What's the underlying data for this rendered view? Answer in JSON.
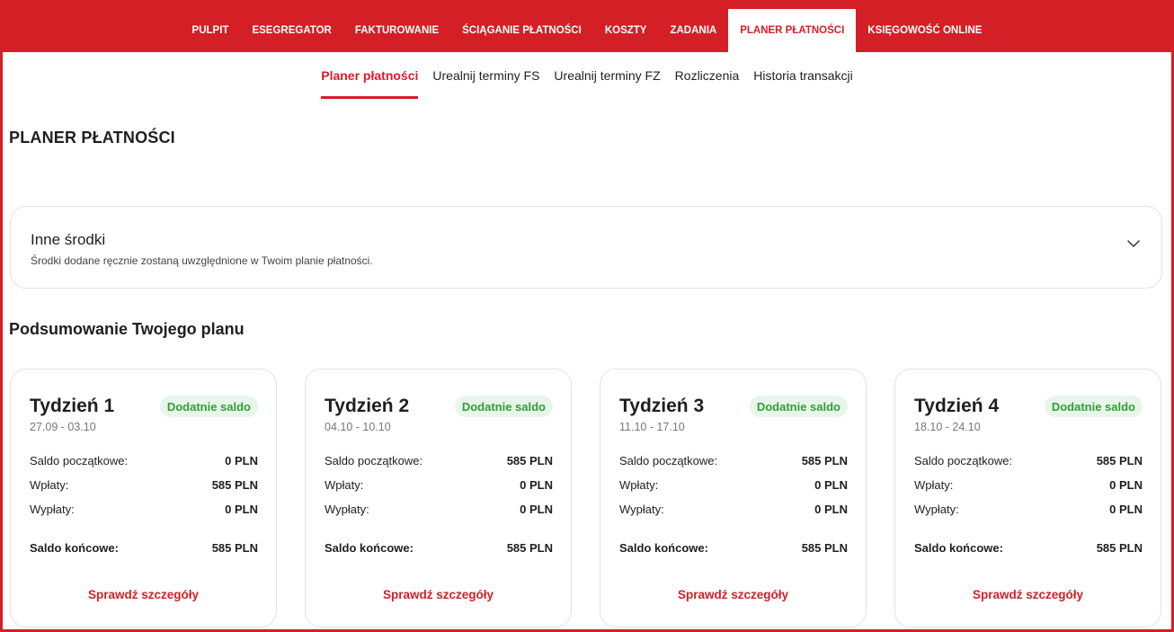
{
  "colors": {
    "brand": "#d51f26",
    "badge_bg": "#e8f6e9",
    "badge_text": "#2f9e3a"
  },
  "topnav": {
    "items": [
      {
        "label": "PULPIT"
      },
      {
        "label": "ESEGREGATOR"
      },
      {
        "label": "FAKTUROWANIE"
      },
      {
        "label": "ŚCIĄGANIE PŁATNOŚCI"
      },
      {
        "label": "KOSZTY"
      },
      {
        "label": "ZADANIA"
      },
      {
        "label": "PLANER PŁATNOŚCI",
        "active": true
      },
      {
        "label": "KSIĘGOWOŚĆ ONLINE"
      }
    ]
  },
  "subnav": {
    "items": [
      {
        "label": "Planer płatności",
        "active": true
      },
      {
        "label": "Urealnij terminy FS"
      },
      {
        "label": "Urealnij terminy FZ"
      },
      {
        "label": "Rozliczenia"
      },
      {
        "label": "Historia transakcji"
      }
    ]
  },
  "page": {
    "title": "PLANER PŁATNOŚCI"
  },
  "other_funds": {
    "title": "Inne środki",
    "description": "Środki dodane ręcznie zostaną uwzględnione w Twoim planie płatności.",
    "icon": "chevron-down-icon"
  },
  "summary": {
    "title": "Podsumowanie Twojego planu",
    "labels": {
      "opening": "Saldo początkowe:",
      "income": "Wpłaty:",
      "payouts": "Wypłaty:",
      "closing": "Saldo końcowe:",
      "details_link": "Sprawdź szczegóły"
    },
    "weeks": [
      {
        "title": "Tydzień 1",
        "dates": "27.09 - 03.10",
        "badge": "Dodatnie saldo",
        "opening": "0 PLN",
        "income": "585 PLN",
        "payouts": "0 PLN",
        "closing": "585 PLN"
      },
      {
        "title": "Tydzień 2",
        "dates": "04.10 - 10.10",
        "badge": "Dodatnie saldo",
        "opening": "585 PLN",
        "income": "0 PLN",
        "payouts": "0 PLN",
        "closing": "585 PLN"
      },
      {
        "title": "Tydzień 3",
        "dates": "11.10 - 17.10",
        "badge": "Dodatnie saldo",
        "opening": "585 PLN",
        "income": "0 PLN",
        "payouts": "0 PLN",
        "closing": "585 PLN"
      },
      {
        "title": "Tydzień 4",
        "dates": "18.10 - 24.10",
        "badge": "Dodatnie saldo",
        "opening": "585 PLN",
        "income": "0 PLN",
        "payouts": "0 PLN",
        "closing": "585 PLN"
      }
    ]
  }
}
